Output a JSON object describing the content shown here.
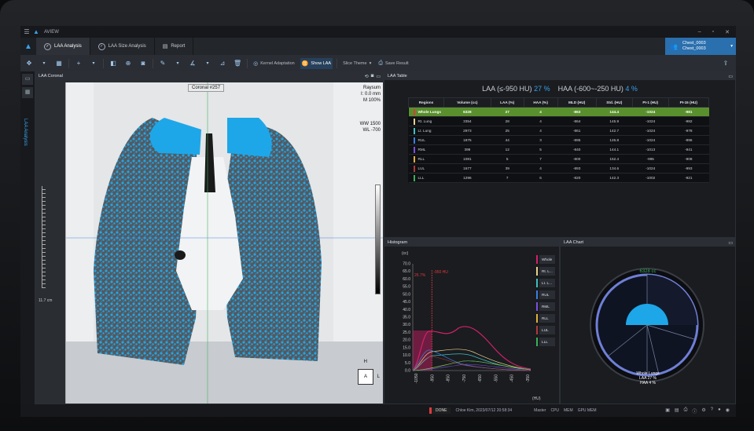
{
  "app": {
    "name": "AVIEW"
  },
  "tabs": [
    {
      "label": "LAA Analysis",
      "active": true
    },
    {
      "label": "LAA Size Analysis",
      "active": false
    },
    {
      "label": "Report",
      "active": false
    }
  ],
  "user": {
    "line1": "Chest_0003",
    "line2": "Chest_0003"
  },
  "toolbar": {
    "kernel_label": "Kernel Adaptation",
    "show_laa_label": "Show LAA",
    "slice_theme_label": "Slice Theme",
    "save_result_label": "Save Result"
  },
  "left_rail": {
    "label": "LAA Analysis"
  },
  "coronal": {
    "panel_title": "LAA Coronal",
    "slice_label": "Coronal #257",
    "orient_sup": "Raysum",
    "thickness": "I: 0.0 mm",
    "magnification": "M 100%",
    "ww": "WW  1500",
    "wl": "WL   -700",
    "ruler_label": "11.7 cm",
    "orient_right": "H",
    "orient_box": "A",
    "orient_l": "L"
  },
  "laa_table": {
    "panel_title": "LAA Table",
    "laa_label": "LAA (≤-950 HU)",
    "laa_pct": "27 %",
    "haa_label": "HAA (-600~-250 HU)",
    "haa_pct": "4 %",
    "headers": [
      "Regions",
      "Volume (cc)",
      "LAA (%)",
      "HAA (%)",
      "MLD (HU)",
      "Std. (HU)",
      "PI-1 (HU)",
      "PI-15 (HU)"
    ],
    "rows": [
      {
        "color": "#e03a3a",
        "cells": [
          "Whole Lungs",
          "6328",
          "27",
          "4",
          "-863",
          "144.4",
          "-1024",
          "-981"
        ],
        "highlight": true
      },
      {
        "color": "#e8d28a",
        "cells": [
          "Rt. Lung",
          "3354",
          "28",
          "4",
          "-864",
          "145.9",
          "-1024",
          "-982"
        ]
      },
      {
        "color": "#3fbfbf",
        "cells": [
          "Lt. Lung",
          "2973",
          "25",
          "4",
          "-861",
          "142.7",
          "-1024",
          "-978"
        ]
      },
      {
        "color": "#3a7fe0",
        "cells": [
          "RUL",
          "1875",
          "44",
          "3",
          "-895",
          "126.8",
          "-1024",
          "-996"
        ]
      },
      {
        "color": "#7a4fe0",
        "cells": [
          "RML",
          "399",
          "12",
          "5",
          "-840",
          "144.1",
          "-1013",
          "-941"
        ]
      },
      {
        "color": "#e0b03a",
        "cells": [
          "RLL",
          "1081",
          "5",
          "7",
          "-800",
          "152.4",
          "-995",
          "-908"
        ]
      },
      {
        "color": "#b03a3a",
        "cells": [
          "LUL",
          "1677",
          "39",
          "4",
          "-893",
          "134.6",
          "-1024",
          "-993"
        ]
      },
      {
        "color": "#3ab05a",
        "cells": [
          "LLL",
          "1296",
          "7",
          "6",
          "-820",
          "142.3",
          "-1002",
          "-921"
        ]
      }
    ]
  },
  "histogram": {
    "panel_title": "Histogram",
    "y_unit": "(cc)",
    "x_unit": "(HU)",
    "y_ticks": [
      "70.0",
      "65.0",
      "60.0",
      "55.0",
      "50.0",
      "45.0",
      "40.0",
      "35.0",
      "30.0",
      "25.0",
      "20.0",
      "15.0",
      "10.0",
      "5.0",
      "0.0"
    ],
    "x_ticks": [
      "-1050",
      "-950",
      "-850",
      "-750",
      "-650",
      "-550",
      "-450",
      "-350"
    ],
    "marker_label": "-950 HU",
    "marker_pct": "26.7%",
    "legend": [
      {
        "label": "Whole",
        "color": "#d4206a"
      },
      {
        "label": "Rt. L...",
        "color": "#e8d28a"
      },
      {
        "label": "Lt. L...",
        "color": "#3fbfbf"
      },
      {
        "label": "RUL",
        "color": "#3a7fe0"
      },
      {
        "label": "RML",
        "color": "#7a4fe0"
      },
      {
        "label": "RLL",
        "color": "#e0b03a"
      },
      {
        "label": "LUL",
        "color": "#b03a3a"
      },
      {
        "label": "LLL",
        "color": "#3ab05a"
      }
    ]
  },
  "laa_chart": {
    "panel_title": "LAA Chart",
    "volume_label": "6328 cc",
    "caption1": "Whole Lungs",
    "caption2": "LAA 27 %",
    "caption3": "HAA 4 %"
  },
  "status": {
    "done": "DONE",
    "user_time": "Chloe Kim, 2023/07/12 20:58:34",
    "master": "Master",
    "cpu": "CPU",
    "mem": "MEM",
    "gpu": "GPU MEM"
  },
  "colors": {
    "accent": "#3aa0e8",
    "highlight_row": "#5a8f2e",
    "laa_overlay": "#1ea7e8"
  }
}
